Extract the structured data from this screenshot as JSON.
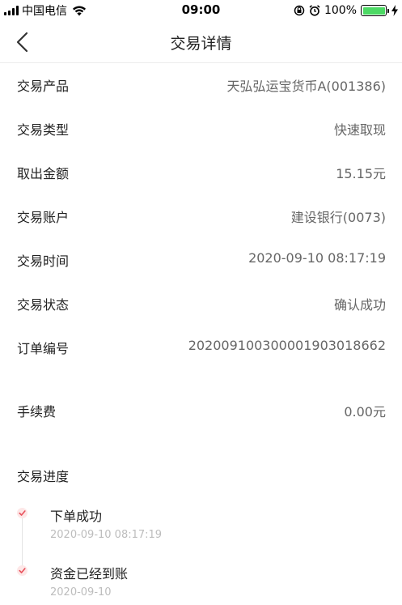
{
  "status_bar": {
    "carrier": "中国电信",
    "time": "09:00",
    "battery_percent": "100%",
    "battery_level": 1.0,
    "battery_color": "#4cd964"
  },
  "nav": {
    "back_icon": "chevron-left-icon",
    "title": "交易详情"
  },
  "details": [
    {
      "label": "交易产品",
      "value": "天弘弘运宝货币A(001386)"
    },
    {
      "label": "交易类型",
      "value": "快速取现"
    },
    {
      "label": "取出金额",
      "value": "15.15元"
    },
    {
      "label": "交易账户",
      "value": "建设银行(0073)"
    },
    {
      "label": "交易时间",
      "value": "2020-09-10 08:17:19"
    },
    {
      "label": "交易状态",
      "value": "确认成功"
    },
    {
      "label": "订单编号",
      "value": "20200910030000190301866​2"
    }
  ],
  "fee": {
    "label": "手续费",
    "value": "0.00元"
  },
  "progress": {
    "title": "交易进度",
    "steps": [
      {
        "title": "下单成功",
        "time": "2020-09-10 08:17:19"
      },
      {
        "title": "资金已经到账",
        "time": "2020-09-10"
      }
    ],
    "accent_color": "#e8505b"
  }
}
